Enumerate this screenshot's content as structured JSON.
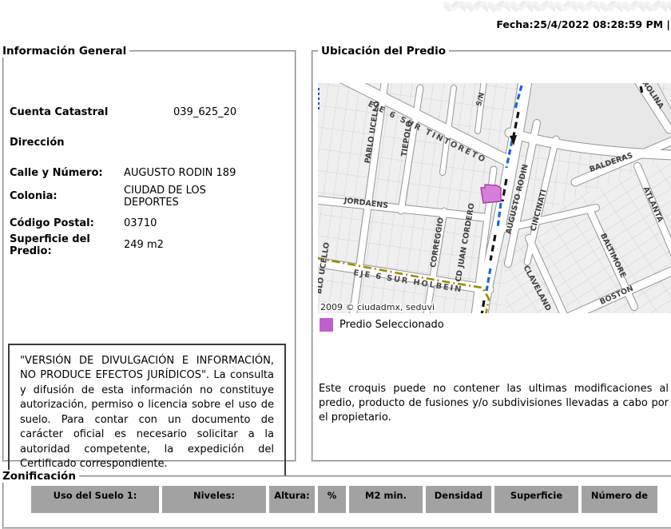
{
  "header": {
    "date": "Fecha:25/4/2022 08:28:59 PM |"
  },
  "general_info": {
    "title": "Información General",
    "cuenta_label": "Cuenta Catastral",
    "cuenta_value": "039_625_20",
    "direccion_label": "Dirección",
    "calle_label": "Calle y Número:",
    "calle_value": "AUGUSTO RODIN 189",
    "colonia_label": "Colonia:",
    "colonia_value": "CIUDAD DE LOS DEPORTES",
    "cp_label": "Código Postal:",
    "cp_value": "03710",
    "superficie_label": "Superficie del Predio:",
    "superficie_value": "249 m2",
    "disclaimer": "\"VERSIÓN DE DIVULGACIÓN E INFORMACIÓN, NO PRODUCE EFECTOS JURÍDICOS\". La consulta y difusión de esta información no constituye autorización, permiso o licencia sobre el uso de suelo. Para contar con un documento de carácter oficial es necesario solicitar a la autoridad competente, la expedición del Certificado correspondiente."
  },
  "ubicacion": {
    "title": "Ubicación del Predio",
    "map": {
      "copyright": "2009 © ciudadmx, seduvi",
      "highlight_color": "#d580d8",
      "streets": {
        "tintoreto": "EJE 6 SUR TINTORETO",
        "sn": "S/N",
        "pablo_ucello": "PABLO UCELLO",
        "tiepolo": "TIEPOLO",
        "rolina": "ROLINA",
        "balderas": "BALDERAS",
        "atlanta": "ATLANTA",
        "jordaens": "JORDAENS",
        "augusto_rodin": "AUGUSTO RODIN",
        "cincinati": "CINCINATI",
        "correggio": "CORREGGIO",
        "juan_cordero": "CD JUAN CORDERO",
        "baltimore": "BALTIMORE",
        "claveland": "CLAVELAND",
        "holbein": "EJE 6 SUR HOLBEIN",
        "blo_ucello": "BLO UCELLO",
        "boston": "BOSTON"
      }
    },
    "legend_label": "Predio Seleccionado",
    "note": "Este croquis puede no contener las ultimas modificaciones al predio, producto de fusiones y/o subdivisiones llevadas a cabo por el propietario."
  },
  "zonificacion": {
    "title": "Zonificación",
    "columns": [
      "Uso del Suelo 1:",
      "Niveles:",
      "Altura:",
      "%",
      "M2 min.",
      "Densidad",
      "Superficie",
      "Número de"
    ]
  }
}
